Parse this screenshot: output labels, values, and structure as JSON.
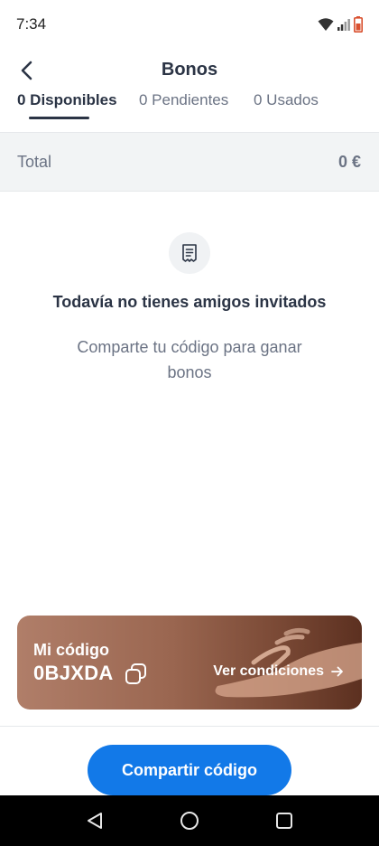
{
  "status_bar": {
    "time": "7:34"
  },
  "header": {
    "title": "Bonos"
  },
  "tabs": [
    {
      "label": "0 Disponibles",
      "active": true
    },
    {
      "label": "0 Pendientes",
      "active": false
    },
    {
      "label": "0 Usados",
      "active": false
    }
  ],
  "total": {
    "label": "Total",
    "value": "0 €"
  },
  "empty_state": {
    "icon": "receipt-icon",
    "title": "Todavía no tienes amigos invitados",
    "subtitle": "Comparte tu código para ganar bonos"
  },
  "code_card": {
    "label": "Mi código",
    "code": "0BJXDA",
    "conditions_label": "Ver condiciones"
  },
  "share_button": {
    "label": "Compartir código"
  },
  "colors": {
    "primary": "#1279e8",
    "text_dark": "#2b3445",
    "text_muted": "#6b7384",
    "card_brown": "#9a6650"
  }
}
